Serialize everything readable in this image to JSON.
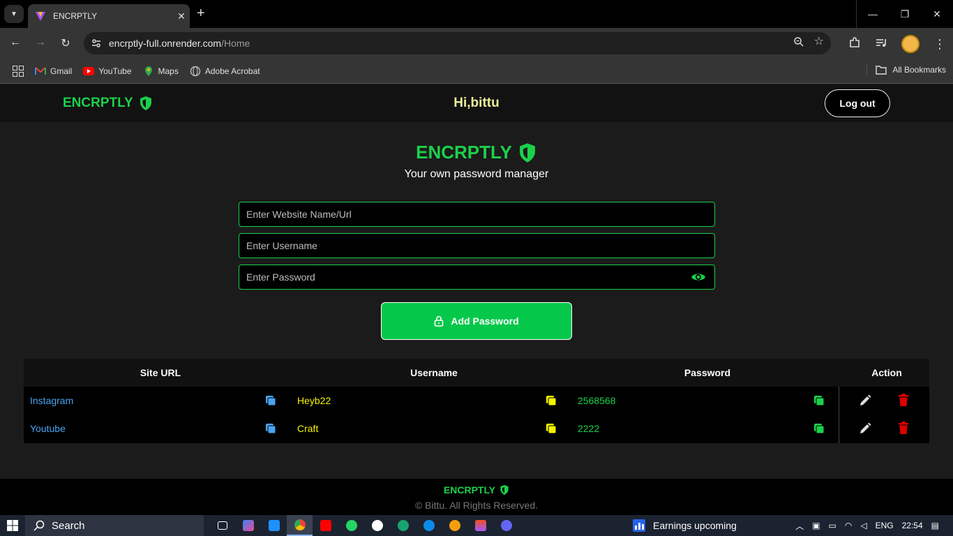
{
  "browser": {
    "tab_title": "ENCRPTLY",
    "url_host": "encrptly-full.onrender.com",
    "url_path": "/Home",
    "bookmarks": [
      "Gmail",
      "YouTube",
      "Maps",
      "Adobe Acrobat"
    ],
    "all_bookmarks": "All Bookmarks"
  },
  "navbar": {
    "brand": "ENCRPTLY",
    "greeting": "Hi,bittu",
    "logout": "Log out"
  },
  "hero": {
    "title": "ENCRPTLY",
    "subtitle": "Your own password manager"
  },
  "form": {
    "site_placeholder": "Enter Website Name/Url",
    "username_placeholder": "Enter Username",
    "password_placeholder": "Enter Password",
    "add_button": "Add Password"
  },
  "table": {
    "headers": [
      "Site URL",
      "Username",
      "Password",
      "Action"
    ],
    "rows": [
      {
        "site": "Instagram",
        "username": "Heyb22",
        "password": "2568568"
      },
      {
        "site": "Youtube",
        "username": "Craft",
        "password": "2222"
      }
    ]
  },
  "footer": {
    "brand": "ENCRPTLY",
    "copyright": "© Bittu. All Rights Reserved."
  },
  "taskbar": {
    "search": "Search",
    "news": "Earnings upcoming",
    "lang": "ENG",
    "time": "22:54"
  },
  "colors": {
    "accent_green": "#1bd14a",
    "button_green": "#05c84a",
    "site_blue": "#4aa3f0",
    "username_yellow": "#f5f500",
    "password_green": "#1bd14a",
    "delete_red": "#e00000"
  }
}
